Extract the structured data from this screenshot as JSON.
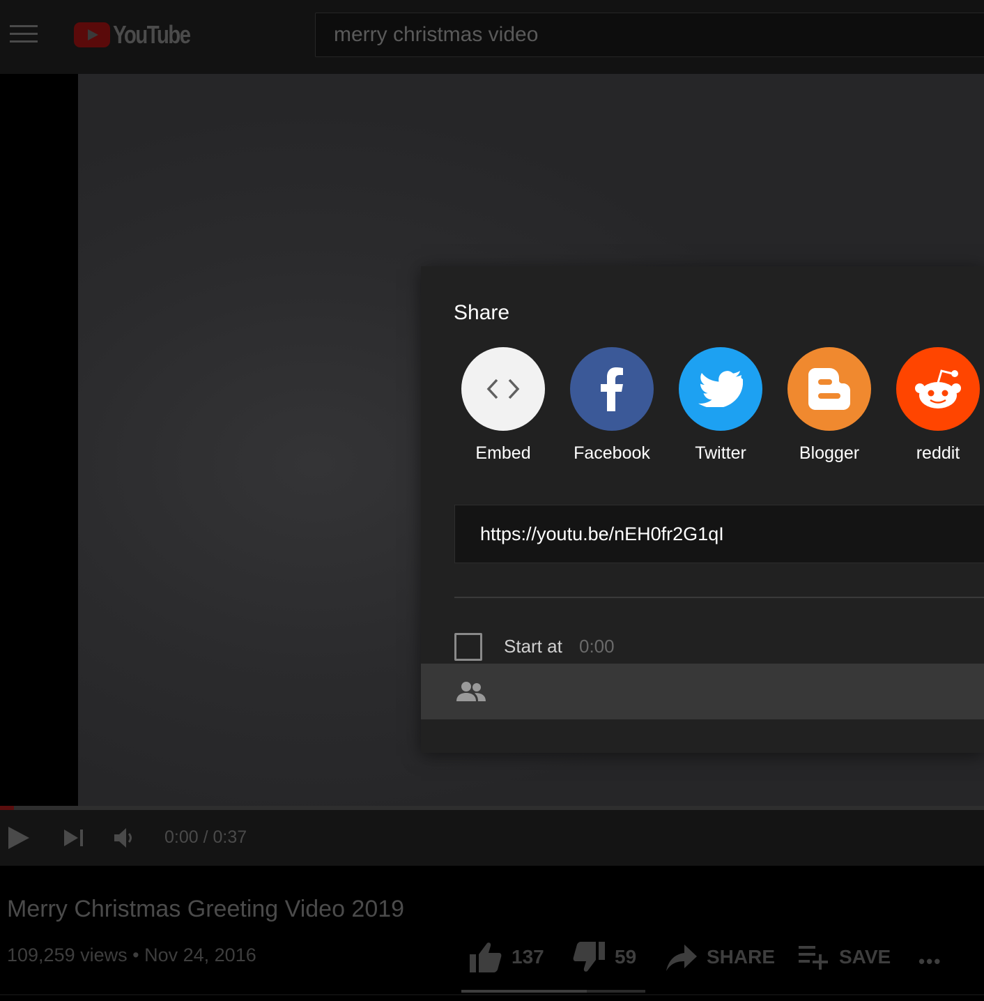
{
  "masthead": {
    "logo_text": "YouTube",
    "search_value": "merry christmas video"
  },
  "player": {
    "time_display": "0:00 / 0:37",
    "progress": 0.0
  },
  "share_dialog": {
    "title": "Share",
    "targets": [
      {
        "label": "Embed",
        "icon": "embed-code-icon",
        "color": "#f2f2f2"
      },
      {
        "label": "Facebook",
        "icon": "facebook-icon",
        "color": "#3b5998"
      },
      {
        "label": "Twitter",
        "icon": "twitter-bird-icon",
        "color": "#1da1f2"
      },
      {
        "label": "Blogger",
        "icon": "blogger-icon",
        "color": "#f0892f"
      },
      {
        "label": "reddit",
        "icon": "reddit-icon",
        "color": "#ff4500"
      }
    ],
    "url": "https://youtu.be/nEH0fr2G1qI",
    "start_at_label": "Start at",
    "start_at_value": "0:00",
    "start_at_checked": false,
    "group_icon": "people-icon"
  },
  "video": {
    "title": "Merry Christmas Greeting Video 2019",
    "views": "109,259 views",
    "separator": "•",
    "date": "Nov 24, 2016",
    "likes": "137",
    "dislikes": "59",
    "share_label": "SHARE",
    "save_label": "SAVE",
    "more_label": "•••"
  }
}
